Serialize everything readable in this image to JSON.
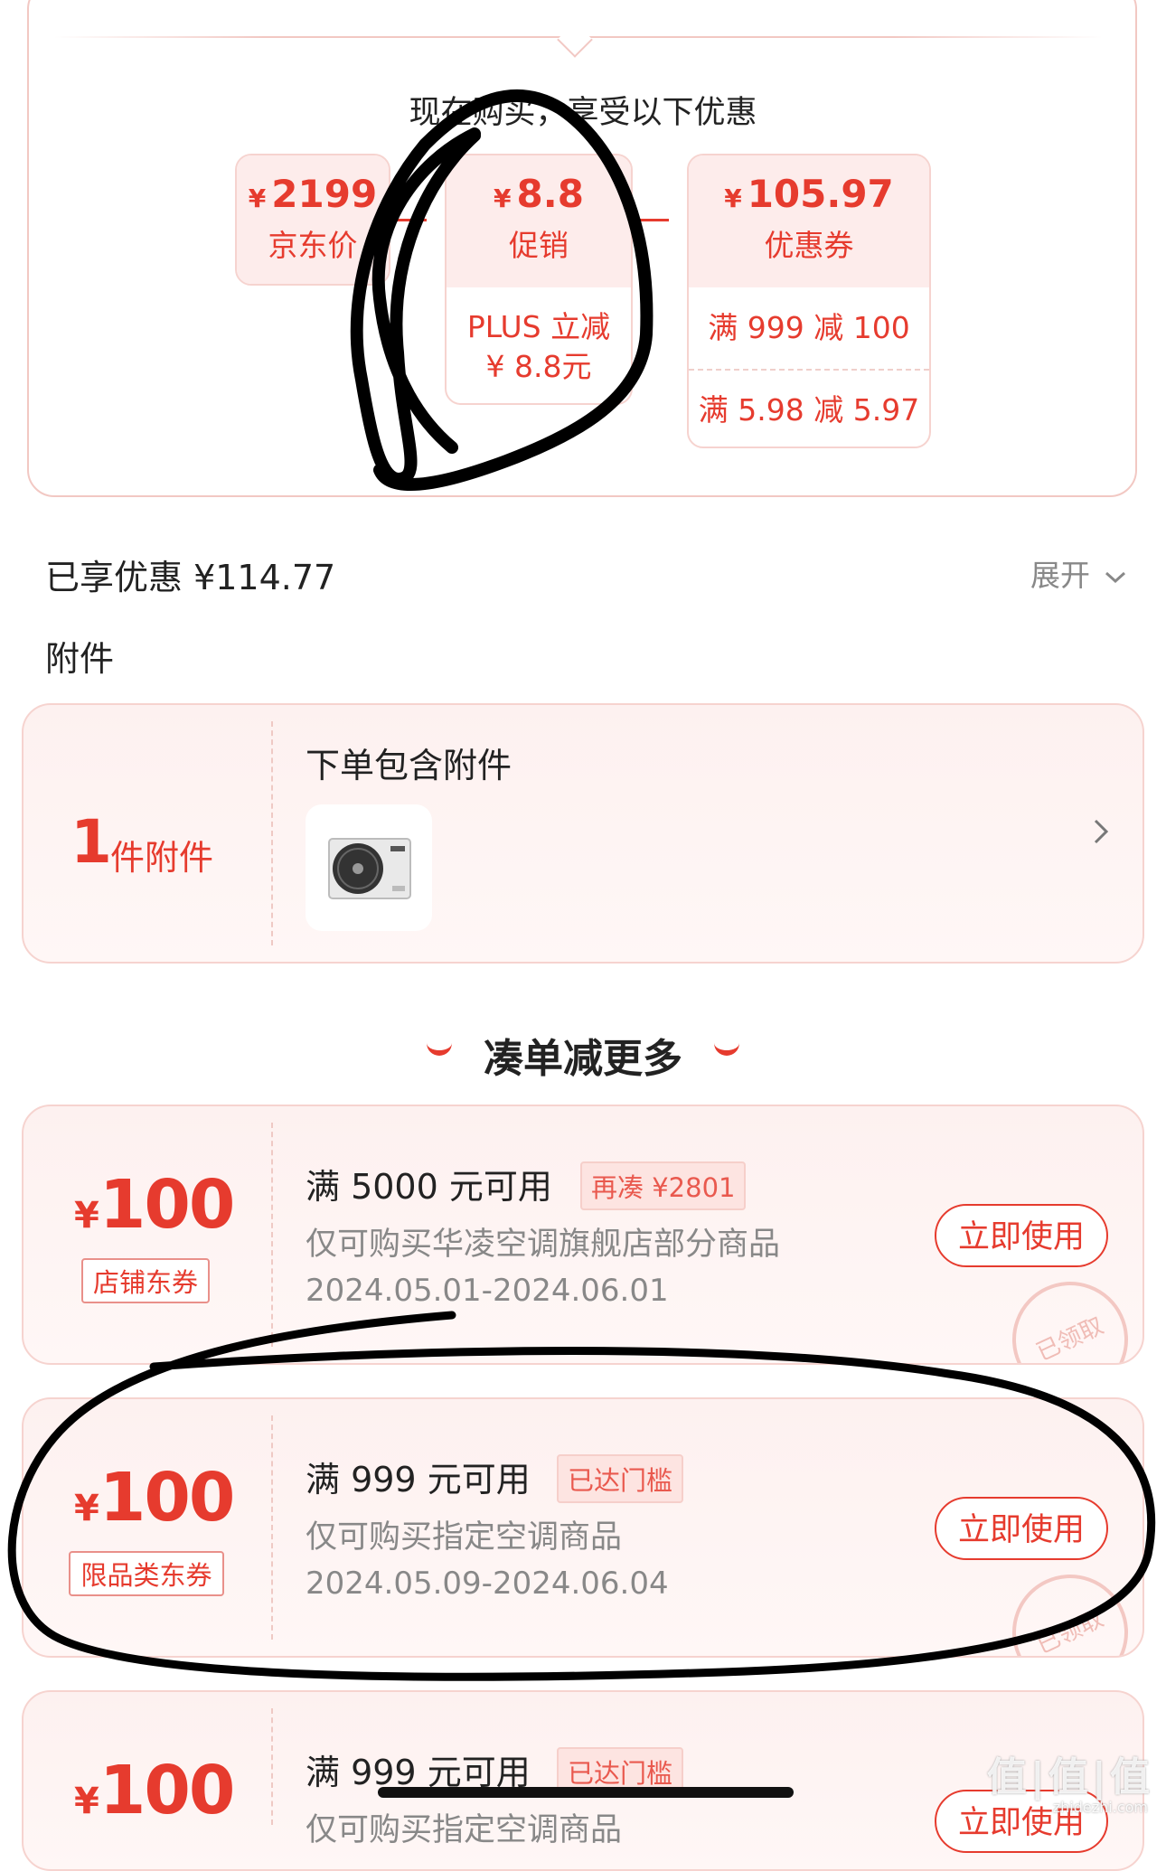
{
  "benefits": {
    "heading": "现在购买，享受以下优惠",
    "jd_price": {
      "amount": "2199",
      "label": "京东价"
    },
    "promo": {
      "amount": "8.8",
      "label": "促销",
      "detail_line1": "PLUS 立减",
      "detail_line2": "¥ 8.8元"
    },
    "coupon": {
      "amount": "105.97",
      "label": "优惠券",
      "rule1": "满 999 减 100",
      "rule2": "满 5.98 减 5.97"
    },
    "yen": "¥"
  },
  "summary": {
    "text": "已享优惠 ¥114.77",
    "expand_label": "展开"
  },
  "accessory": {
    "section_title": "附件",
    "count": "1",
    "unit": "件附件",
    "text": "下单包含附件",
    "thumb_icon": "air-conditioner-outdoor-unit"
  },
  "promo_section": {
    "title": "凑单减更多"
  },
  "coupons": [
    {
      "yen": "¥",
      "amount": "100",
      "tag": "店铺东券",
      "rule": "满 5000 元可用",
      "badge": "再凑 ¥2801",
      "scope": "仅可购买华凌空调旗舰店部分商品",
      "date": "2024.05.01-2024.06.01",
      "button": "立即使用",
      "stamp": "已领取"
    },
    {
      "yen": "¥",
      "amount": "100",
      "tag": "限品类东券",
      "rule": "满 999 元可用",
      "badge": "已达门槛",
      "scope": "仅可购买指定空调商品",
      "date": "2024.05.09-2024.06.04",
      "button": "立即使用",
      "stamp": "已领取"
    },
    {
      "yen": "¥",
      "amount": "100",
      "rule": "满 999 元可用",
      "badge": "已达门槛",
      "scope": "仅可购买指定空调商品",
      "button": "立即使用"
    }
  ],
  "watermark": {
    "text": "值|值|值",
    "sub": "zhidezhi.com"
  },
  "colors": {
    "accent": "#e63b2e",
    "card_bg": "#fdf1f0",
    "ink": "#000000"
  }
}
